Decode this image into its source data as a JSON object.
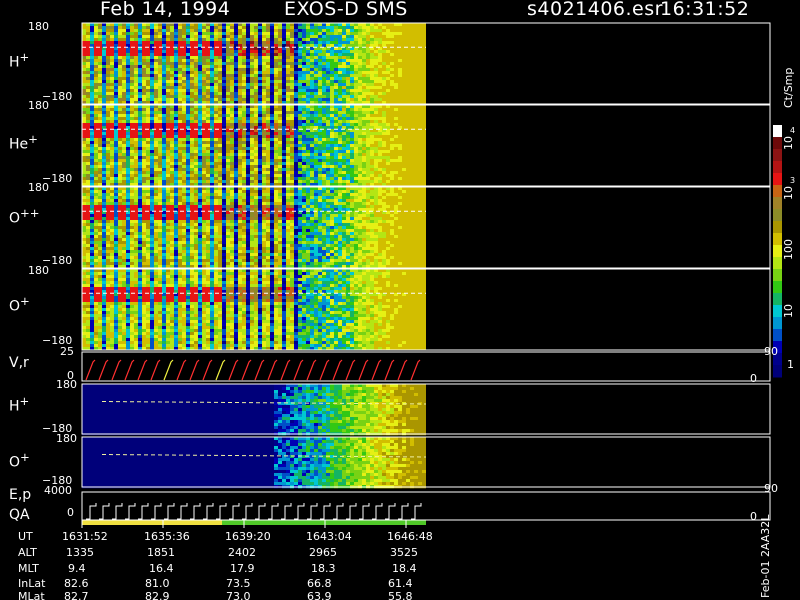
{
  "header": {
    "date": "Feb 14, 1994",
    "instrument": "EXOS-D SMS",
    "file": "s4021406.esr",
    "time": "16:31:52"
  },
  "colorbar": {
    "unit": "Ct/Smp",
    "tick_labels": [
      "1",
      "10",
      "100",
      "10",
      "3",
      "10",
      "4"
    ],
    "colors": [
      "#00007a",
      "#00008c",
      "#0000b4",
      "#0050c8",
      "#0096d2",
      "#00c8d2",
      "#14b464",
      "#32c814",
      "#78d214",
      "#b4e614",
      "#e6f014",
      "#d2be00",
      "#aa9600",
      "#8c8c28",
      "#a08228",
      "#c86414",
      "#e61414",
      "#b41414",
      "#8c1414",
      "#6e0a0a",
      "#ffffff"
    ]
  },
  "panels": [
    {
      "label": "H",
      "sup": "+",
      "ymax": "180",
      "ymin": "−180"
    },
    {
      "label": "He",
      "sup": "+",
      "ymax": "180",
      "ymin": "−180"
    },
    {
      "label": "O",
      "sup": "++",
      "ymax": "180",
      "ymin": "−180"
    },
    {
      "label": "O",
      "sup": "+",
      "ymax": "180",
      "ymin": "−180"
    },
    {
      "label": "V,r",
      "sup": "",
      "ymax": "25",
      "ymin": "0",
      "right_max": "90",
      "right_min": "0"
    },
    {
      "label": "H",
      "sup": "+",
      "ymax": "180",
      "ymin": "−180"
    },
    {
      "label": "O",
      "sup": "+",
      "ymax": "180",
      "ymin": "−180"
    },
    {
      "label": "E,p",
      "label2": "QA",
      "sup": "",
      "ymax": "4000",
      "ymin": "0",
      "right_max": "90",
      "right_min": "0"
    }
  ],
  "ephemeris": {
    "rows": [
      {
        "name": "UT",
        "values": [
          "1631:52",
          "1635:36",
          "1639:20",
          "1643:04",
          "1646:48"
        ]
      },
      {
        "name": "ALT",
        "values": [
          "1335",
          "1851",
          "2402",
          "2965",
          "3525"
        ]
      },
      {
        "name": "MLT",
        "values": [
          "9.4",
          "16.4",
          "17.9",
          "18.3",
          "18.4"
        ]
      },
      {
        "name": "InLat",
        "values": [
          "82.6",
          "81.0",
          "73.5",
          "66.8",
          "61.4"
        ]
      },
      {
        "name": "MLat",
        "values": [
          "82.7",
          "82.9",
          "73.0",
          "63.9",
          "55.8"
        ]
      }
    ]
  },
  "footer_vertical": "Feb-01 2AA32L"
}
